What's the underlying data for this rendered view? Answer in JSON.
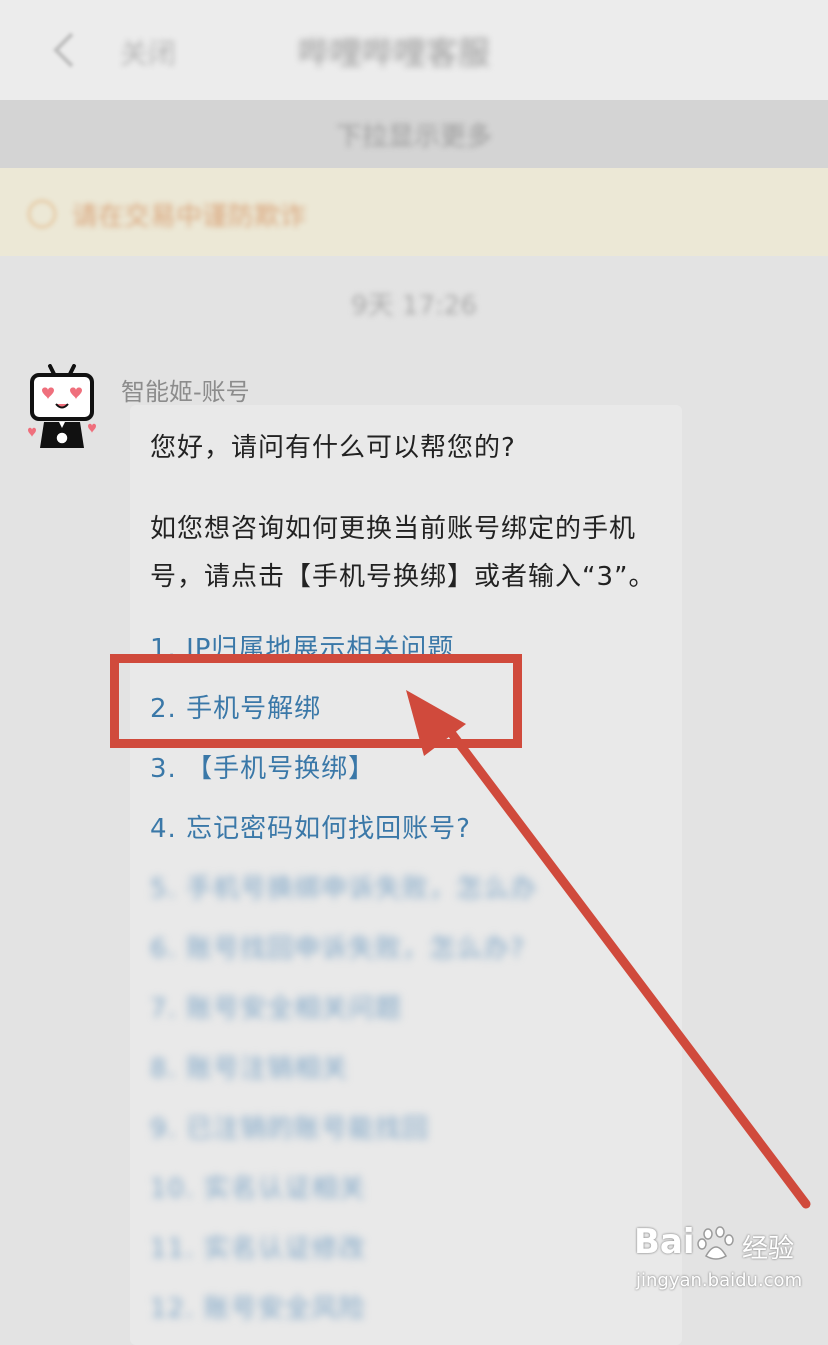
{
  "header": {
    "back_label": "关闭",
    "title": "哔哩哔哩客服",
    "subtitle": "下拉显示更多"
  },
  "notice": {
    "text": "请在交易中谨防欺诈"
  },
  "chat": {
    "timestamp": "9天 17:26",
    "sender_name": "智能姬-账号",
    "greeting": "您好，请问有什么可以帮您的?",
    "hint_line1": "如您想咨询如何更换当前账号绑定的手机",
    "hint_line2": "号，请点击【手机号换绑】或者输入“3”。",
    "options": [
      "1. IP归属地展示相关问题",
      "2. 手机号解绑",
      "3. 【手机号换绑】",
      "4. 忘记密码如何找回账号?",
      "5. 手机号换绑申诉失败，怎么办",
      "6. 账号找回申诉失败，怎么办?",
      "7. 账号安全相关问题",
      "8. 账号注销相关",
      "9. 已注销的账号能找回",
      "10. 实名认证相关",
      "11. 实名认证修改",
      "12. 账号安全风险"
    ]
  },
  "annotation": {
    "highlight_color": "#d04a3c"
  },
  "watermark": {
    "logo": "Bai",
    "brand": "经验",
    "url": "jingyan.baidu.com"
  }
}
